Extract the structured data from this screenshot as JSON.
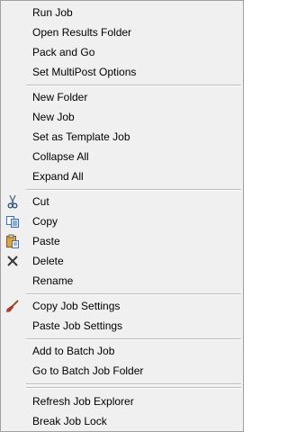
{
  "menu": {
    "items": [
      {
        "label": "Run Job"
      },
      {
        "label": "Open Results Folder"
      },
      {
        "label": "Pack and Go"
      },
      {
        "label": "Set MultiPost Options"
      },
      {
        "label": "New Folder"
      },
      {
        "label": "New Job"
      },
      {
        "label": "Set as Template Job"
      },
      {
        "label": "Collapse All"
      },
      {
        "label": "Expand All"
      },
      {
        "label": "Cut",
        "icon": "scissors-icon"
      },
      {
        "label": "Copy",
        "icon": "copy-icon"
      },
      {
        "label": "Paste",
        "icon": "paste-icon"
      },
      {
        "label": "Delete",
        "icon": "delete-x-icon"
      },
      {
        "label": "Rename"
      },
      {
        "label": "Copy Job Settings",
        "icon": "brush-icon"
      },
      {
        "label": "Paste Job Settings"
      },
      {
        "label": "Add to Batch Job"
      },
      {
        "label": "Go to Batch Job Folder"
      },
      {
        "label": "Refresh Job Explorer"
      },
      {
        "label": "Break Job Lock"
      }
    ]
  }
}
